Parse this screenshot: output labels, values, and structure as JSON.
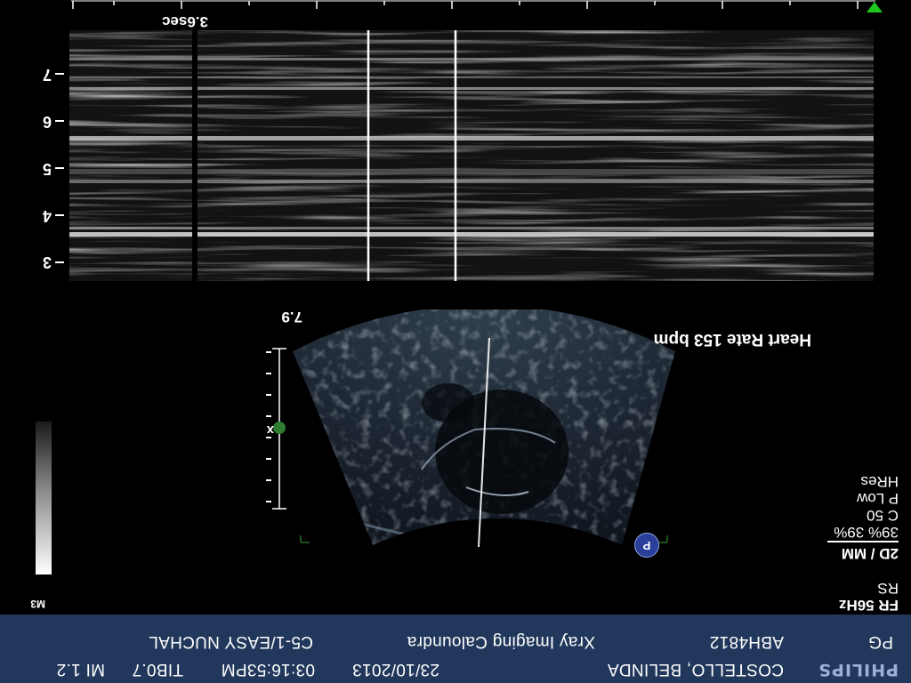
{
  "header": {
    "logo": "PHILIPS",
    "patient_name": "COSTELLO, BELINDA",
    "date": "23/10/2013",
    "time": "03:16:53PM",
    "tib": "TIB0.7",
    "mi": "MI 1.2",
    "patient_id": "ABH4812",
    "institution": "Xray Imaging Caloundra",
    "probe_preset": "C5-1/EASY NUCHAL",
    "pg": "PG"
  },
  "params": {
    "fr": "FR 56Hz",
    "rs": "RS",
    "mode": "2D / MM",
    "gain": "39%   39%",
    "compression": "C 50",
    "power": "P Low",
    "resolution": "HRes",
    "mode_tag": "M3"
  },
  "sector": {
    "heart_rate": "Heart Rate  153 bpm",
    "depth_label": "7.9",
    "marker": "x",
    "badge": "P"
  },
  "mmode": {
    "time_label": "3.6sec",
    "depth_ticks": [
      "3",
      "4",
      "5",
      "6",
      "7"
    ]
  },
  "colors": {
    "header_bg": "#21385c",
    "logo": "#9fb0d8",
    "marker_green": "#2e7d32",
    "triangle_green": "#1ec81e"
  }
}
